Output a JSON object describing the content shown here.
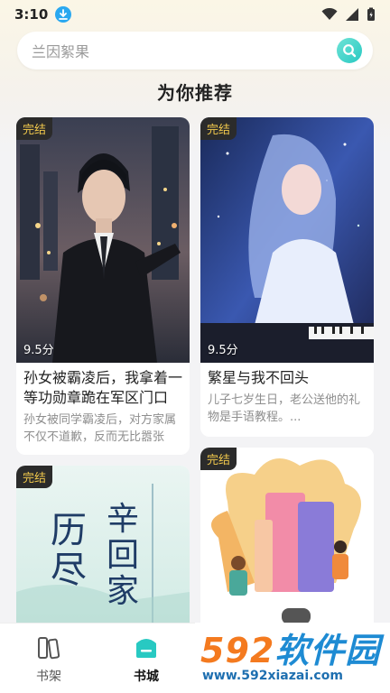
{
  "status": {
    "time": "3:10"
  },
  "search": {
    "placeholder": "兰因絮果"
  },
  "section": {
    "title": "为你推荐"
  },
  "books": [
    {
      "tag": "完结",
      "score": "9.5分",
      "title": "孙女被霸凌后，我拿着一等功勋章跪在军区门口",
      "desc": "孙女被同学霸凌后，对方家属不仅不道歉，反而无比嚣张"
    },
    {
      "tag": "完结",
      "score": "9.5分",
      "title": "繁星与我不回头",
      "desc": "儿子七岁生日，老公送他的礼物是手语教程。..."
    },
    {
      "tag": "完结",
      "cover_text": [
        "历",
        "尽",
        "辛",
        "回",
        "家"
      ]
    },
    {
      "tag": "完结"
    }
  ],
  "tabs": [
    {
      "label": "书架"
    },
    {
      "label": "书城"
    }
  ],
  "watermark": {
    "brand_num": "592",
    "brand_cn": "软件园",
    "url": "www.592xiazai.com"
  },
  "colors": {
    "accent": "#28c9c2",
    "tag_text": "#f2c94c",
    "tag_bg": "#2b2b2b"
  }
}
